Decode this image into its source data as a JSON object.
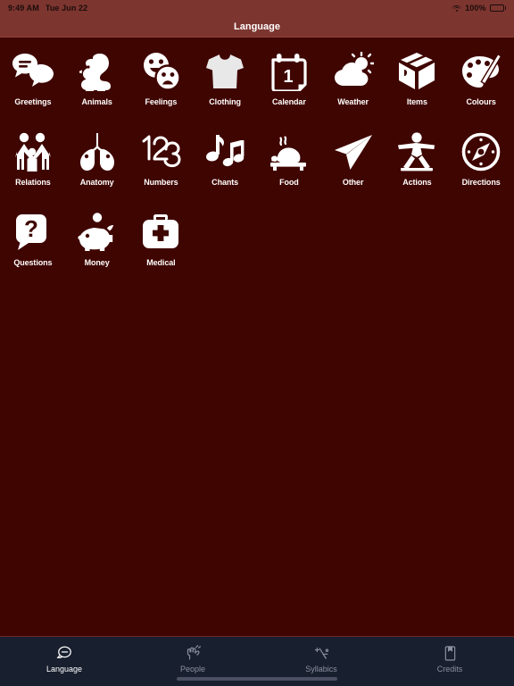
{
  "status_bar": {
    "time": "9:49 AM",
    "date": "Tue Jun 22",
    "battery_percent": "100%",
    "wifi_icon": "wifi-icon",
    "battery_icon": "battery-full-icon"
  },
  "navbar": {
    "title": "Language"
  },
  "colors": {
    "navbar_bg": "#7d352f",
    "content_bg": "#3f0500",
    "tabbar_bg": "#181f2e",
    "icon_fill": "#ffffff",
    "tab_active": "#ffffff",
    "tab_inactive": "#8b90a0"
  },
  "grid": {
    "items": [
      {
        "label": "Greetings",
        "icon": "speech-bubbles-icon"
      },
      {
        "label": "Animals",
        "icon": "squirrel-icon"
      },
      {
        "label": "Feelings",
        "icon": "emoji-faces-icon"
      },
      {
        "label": "Clothing",
        "icon": "t-shirt-icon"
      },
      {
        "label": "Calendar",
        "icon": "calendar-icon",
        "badge": "1"
      },
      {
        "label": "Weather",
        "icon": "sun-cloud-icon"
      },
      {
        "label": "Items",
        "icon": "box-icon"
      },
      {
        "label": "Colours",
        "icon": "paint-palette-icon"
      },
      {
        "label": "Relations",
        "icon": "family-icon"
      },
      {
        "label": "Anatomy",
        "icon": "lungs-icon"
      },
      {
        "label": "Numbers",
        "icon": "one-two-three-icon"
      },
      {
        "label": "Chants",
        "icon": "music-notes-icon"
      },
      {
        "label": "Food",
        "icon": "roast-food-icon"
      },
      {
        "label": "Other",
        "icon": "paper-plane-icon"
      },
      {
        "label": "Actions",
        "icon": "person-action-icon"
      },
      {
        "label": "Directions",
        "icon": "compass-icon"
      },
      {
        "label": "Questions",
        "icon": "question-bubble-icon"
      },
      {
        "label": "Money",
        "icon": "piggy-bank-icon"
      },
      {
        "label": "Medical",
        "icon": "first-aid-kit-icon"
      }
    ]
  },
  "tabbar": {
    "tabs": [
      {
        "label": "Language",
        "icon": "speech-bubble-icon",
        "selected": true
      },
      {
        "label": "People",
        "icon": "people-hand-icon",
        "selected": false
      },
      {
        "label": "Syllabics",
        "icon": "syllabics-icon",
        "selected": false
      },
      {
        "label": "Credits",
        "icon": "document-icon",
        "selected": false
      }
    ]
  }
}
